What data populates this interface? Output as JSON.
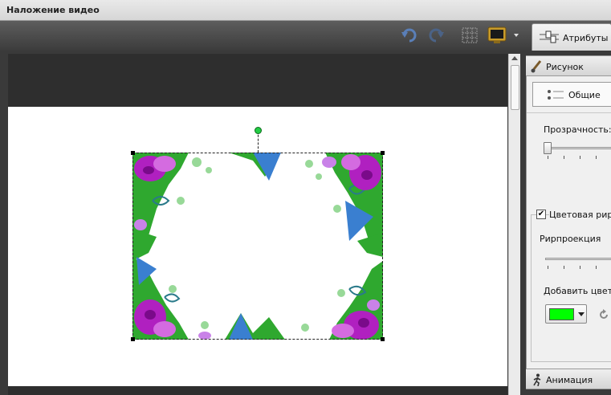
{
  "window": {
    "title": "Наложение видео"
  },
  "toolbar": {
    "undo_icon": "undo-icon",
    "redo_icon": "redo-icon",
    "grid_icon": "grid-icon",
    "monitor_icon": "monitor-icon",
    "attributes_tab_label": "Атрибуты"
  },
  "panel": {
    "picture_section": "Рисунок",
    "general_subtab": "Общие",
    "transparency_label": "Прозрачность:",
    "transparency_value": 0,
    "chroma_key_checkbox_label": "Цветовая рирпроекция",
    "chroma_key_checked": true,
    "chroma_key_label": "Рирпроекция",
    "chroma_key_value": 0,
    "add_color_label": "Добавить цвет:",
    "selected_color": "#00ff00",
    "animation_section": "Анимация"
  },
  "colors": {
    "accent_green": "#00ff00",
    "toolbar_dark": "#3c3c3c"
  }
}
